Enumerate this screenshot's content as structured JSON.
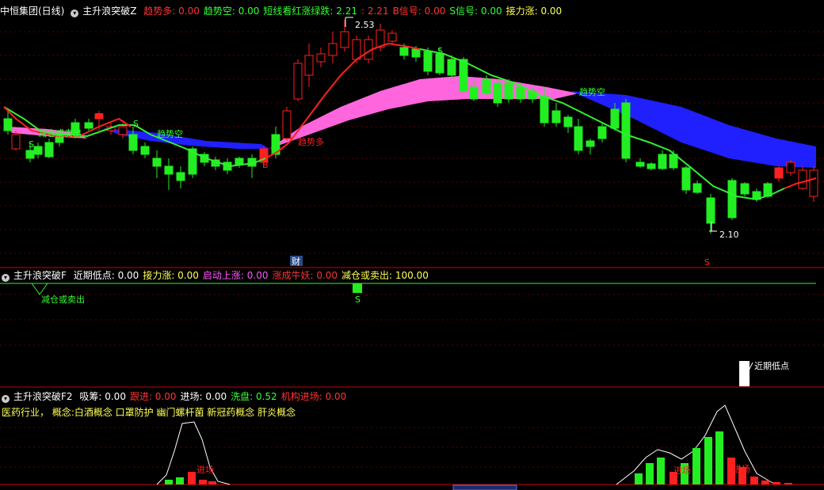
{
  "panel1": {
    "stock_name": "中恒集团(日线)",
    "indicator": "主升浪突破Z",
    "fields": [
      {
        "label": "趋势多:",
        "value": "0.00",
        "color": "#ff3333"
      },
      {
        "label": "趋势空:",
        "value": "0.00",
        "color": "#33ff33"
      },
      {
        "label": "短线看红涨绿跌:",
        "value": "2.21",
        "color": "#33ff33"
      },
      {
        "label": ":",
        "value": "2.21",
        "color": "#ff3333"
      },
      {
        "label": "B信号:",
        "value": "0.00",
        "color": "#ff3333"
      },
      {
        "label": "S信号:",
        "value": "0.00",
        "color": "#33ff33"
      },
      {
        "label": "接力涨:",
        "value": "0.00",
        "color": "#ffff55"
      }
    ],
    "annotations": {
      "high": "2.53",
      "low": "2.10",
      "trend_empty_1": "趋势空",
      "trend_empty_2": "趋势空",
      "trend_long": "趋势多",
      "reduce_sell": "减仓或卖出",
      "s_mark": "S",
      "b_mark": "B",
      "fin_badge": "财",
      "s_red": "S"
    }
  },
  "panel2": {
    "indicator": "主升浪突破F",
    "fields": [
      {
        "label": "近期低点:",
        "value": "0.00",
        "color": "#ffffff"
      },
      {
        "label": "接力涨:",
        "value": "0.00",
        "color": "#ffff55"
      },
      {
        "label": "启动上涨:",
        "value": "0.00",
        "color": "#ff55ff"
      },
      {
        "label": "涨成牛妖:",
        "value": "0.00",
        "color": "#ff3333"
      },
      {
        "label": "减仓或卖出:",
        "value": "100.00",
        "color": "#ffff55"
      }
    ],
    "annotations": {
      "reduce_sell": "减仓或卖出",
      "s_mark": "S",
      "recent_low": "近期低点"
    }
  },
  "panel3": {
    "indicator": "主升浪突破F2",
    "fields": [
      {
        "label": "吸筹:",
        "value": "0.00",
        "color": "#ffffff"
      },
      {
        "label": "跟进:",
        "value": "0.00",
        "color": "#ff3333"
      },
      {
        "label": "进场:",
        "value": "0.00",
        "color": "#ffffff"
      },
      {
        "label": "洗盘:",
        "value": "0.52",
        "color": "#33ff33"
      },
      {
        "label": "机构进场:",
        "value": "0.00",
        "color": "#ff3333"
      }
    ],
    "concept_line": "医药行业， 概念:白酒概念 口罩防护 幽门螺杆菌 新冠药概念 肝炎概念",
    "annotations": {
      "enter_1": "进场",
      "enter_2": "进场",
      "enter_3": "进场"
    }
  }
}
